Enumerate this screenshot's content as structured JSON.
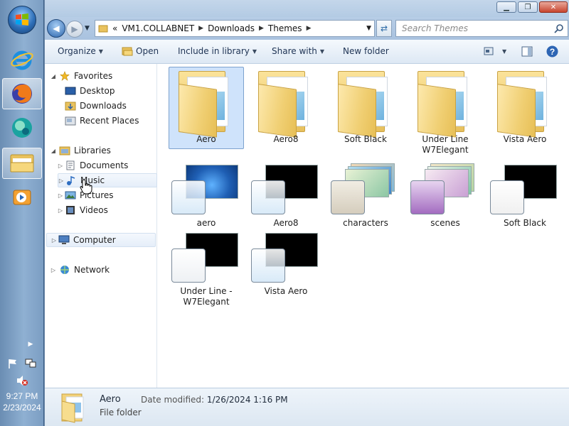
{
  "taskbar": {
    "items": [
      {
        "name": "internet-explorer",
        "active": false
      },
      {
        "name": "firefox",
        "active": true
      },
      {
        "name": "app-sphere",
        "active": false
      },
      {
        "name": "windows-explorer",
        "active": true
      },
      {
        "name": "media-player",
        "active": false
      }
    ],
    "clock_time": "9:27 PM",
    "clock_date": "2/23/2024"
  },
  "window": {
    "controls": {
      "minimize": "▁",
      "maximize": "❐",
      "close": "✕"
    }
  },
  "address": {
    "prefix": "«",
    "segments": [
      "VM1.COLLABNET",
      "Downloads",
      "Themes"
    ]
  },
  "search": {
    "placeholder": "Search Themes"
  },
  "toolbar": {
    "organize": "Organize",
    "open": "Open",
    "include_in_library": "Include in library",
    "share_with": "Share with",
    "new_folder": "New folder"
  },
  "navpane": {
    "favorites": "Favorites",
    "desktop": "Desktop",
    "downloads": "Downloads",
    "recent_places": "Recent Places",
    "libraries": "Libraries",
    "documents": "Documents",
    "music": "Music",
    "pictures": "Pictures",
    "videos": "Videos",
    "computer": "Computer",
    "network": "Network"
  },
  "items": [
    {
      "label": "Aero",
      "type": "folder",
      "selected": true
    },
    {
      "label": "Aero8",
      "type": "folder"
    },
    {
      "label": "Soft Black",
      "type": "folder"
    },
    {
      "label": "Under Line W7Elegant",
      "type": "folder"
    },
    {
      "label": "Vista Aero",
      "type": "folder"
    },
    {
      "label": "aero",
      "type": "theme",
      "wallpaper": "#2a6fc4"
    },
    {
      "label": "Aero8",
      "type": "theme",
      "wallpaper": "#000000"
    },
    {
      "label": "characters",
      "type": "theme-pack"
    },
    {
      "label": "scenes",
      "type": "theme-pack"
    },
    {
      "label": "Soft Black",
      "type": "theme",
      "wallpaper": "#000000"
    },
    {
      "label": "Under Line - W7Elegant",
      "type": "theme",
      "wallpaper": "#000000"
    },
    {
      "label": "Vista Aero",
      "type": "theme",
      "wallpaper": "#000000"
    }
  ],
  "details": {
    "name": "Aero",
    "type": "File folder",
    "modified_label": "Date modified:",
    "modified_value": "1/26/2024 1:16 PM"
  }
}
